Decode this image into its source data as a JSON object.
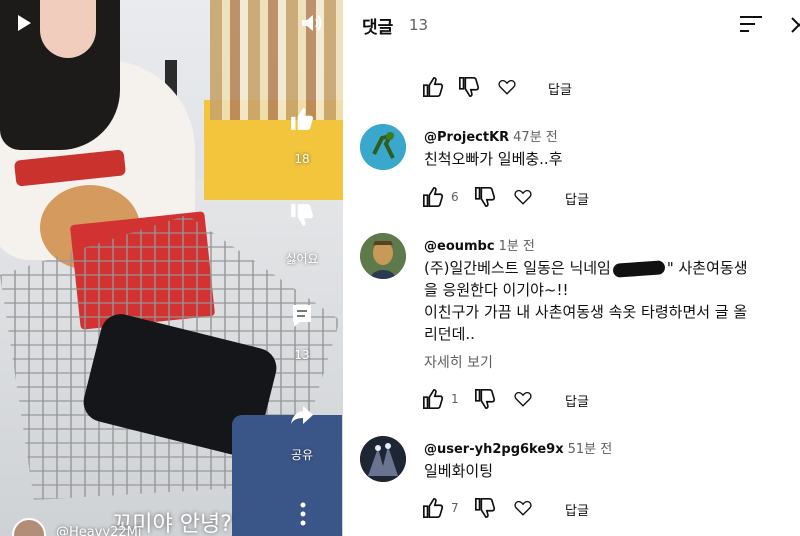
{
  "video": {
    "caption": "꼬미야 안녕?",
    "channel_name": "@Heavy22Mi",
    "like_count": "18",
    "dislike_label": "싫어요",
    "comment_count": "13",
    "share_label": "공유"
  },
  "comments_panel": {
    "title": "댓글",
    "count": "13",
    "reply_label": "답글",
    "top_actions": {
      "reply_label": "답글"
    },
    "comments": [
      {
        "handle": "@ProjectKR",
        "time": "47분 전",
        "lines": [
          "친척오빠가 일베충..후"
        ],
        "likes": "6",
        "reply_label": "답글"
      },
      {
        "handle": "@eoumbc",
        "time": "1분 전",
        "lines": [
          "(주)일간베스트 일동은 닉네임",
          "\" 사촌여동생",
          "을 응원한다 이기야~!!",
          "이친구가 가끔 내 사촌여동생 속옷 타령하면서 글 올",
          "리던데.."
        ],
        "more": "자세히 보기",
        "likes": "1",
        "reply_label": "답글"
      },
      {
        "handle": "@user-yh2pg6ke9x",
        "time": "51분 전",
        "lines": [
          "일베화이팅"
        ],
        "likes": "7",
        "reply_label": "답글"
      }
    ]
  },
  "colors": {
    "text_primary": "#0f0f0f",
    "text_secondary": "#606060",
    "cart_red": "#d33233",
    "shelf_yellow": "#f2c53d"
  }
}
